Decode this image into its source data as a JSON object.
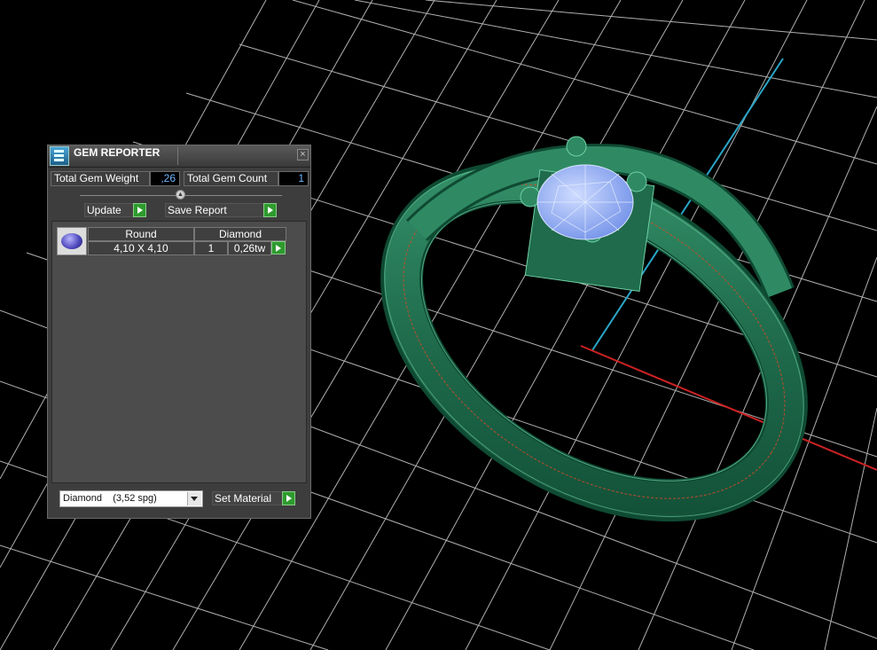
{
  "panel": {
    "title": "GEM REPORTER",
    "close_glyph": "×",
    "collapse_glyph": "▲",
    "total_gem_weight_label": "Total Gem Weight",
    "total_gem_weight_value": ",26",
    "total_gem_count_label": "Total Gem Count",
    "total_gem_count_value": "1",
    "update_label": "Update",
    "save_report_label": "Save Report",
    "gems": [
      {
        "shape": "Round",
        "size": "4,10 X 4,10",
        "material": "Diamond",
        "count": "1",
        "weight": "0,26tw"
      }
    ],
    "material_select": "Diamond    (3,52 spg)",
    "set_material_label": "Set Material"
  },
  "icons": [
    "app-icon",
    "close-icon",
    "collapse-icon",
    "play-arrow-icon",
    "gem-thumbnail",
    "dropdown-arrow-icon"
  ],
  "colors": {
    "ring": "#2e7d5b",
    "gem": "#8fb0ff",
    "grid": "#c8c8c8",
    "x_axis": "#cc2222",
    "y_axis": "#2aa6c7",
    "panel_bg": "#3d3d3d",
    "go_button": "#2e9b2e"
  }
}
